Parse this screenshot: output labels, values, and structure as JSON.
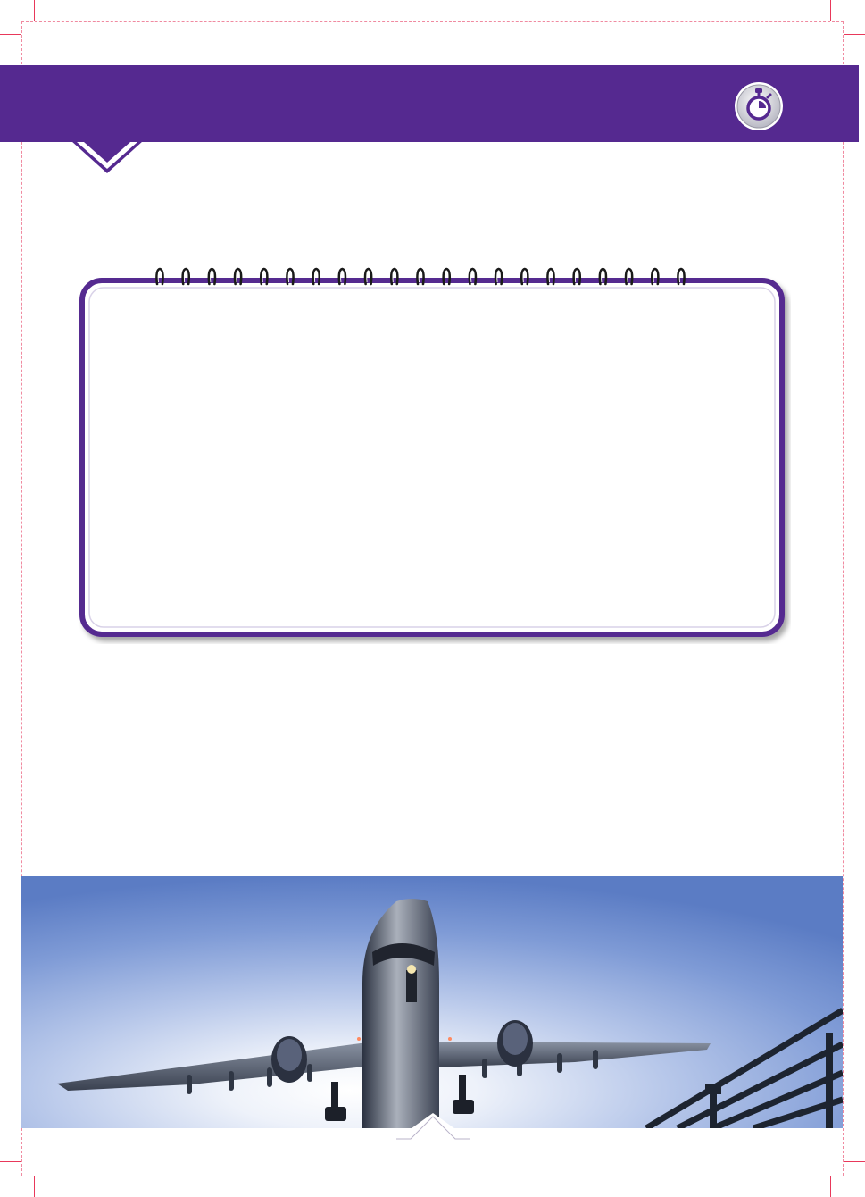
{
  "page": {
    "accent_color": "#552990",
    "header_band_color": "#552990",
    "crop_mark_color": "#e8385a"
  },
  "header": {
    "icon": "stopwatch-icon",
    "title": ""
  },
  "notepad": {
    "binding": "spiral-rings",
    "border_color": "#552990",
    "content": ""
  },
  "photo": {
    "subject": "airplane-takeoff"
  }
}
